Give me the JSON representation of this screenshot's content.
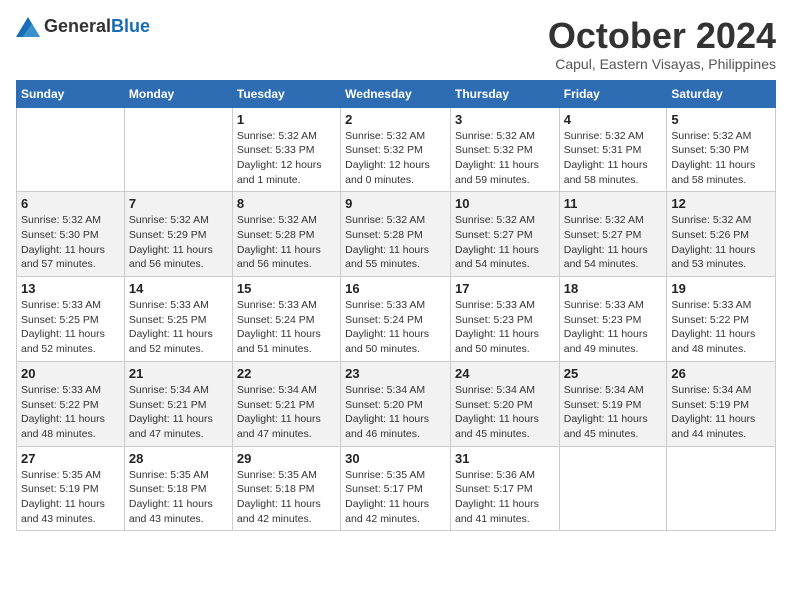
{
  "header": {
    "logo": {
      "general": "General",
      "blue": "Blue"
    },
    "title": "October 2024",
    "subtitle": "Capul, Eastern Visayas, Philippines"
  },
  "columns": [
    "Sunday",
    "Monday",
    "Tuesday",
    "Wednesday",
    "Thursday",
    "Friday",
    "Saturday"
  ],
  "weeks": [
    [
      {
        "day": "",
        "sunrise": "",
        "sunset": "",
        "daylight": ""
      },
      {
        "day": "",
        "sunrise": "",
        "sunset": "",
        "daylight": ""
      },
      {
        "day": "1",
        "sunrise": "Sunrise: 5:32 AM",
        "sunset": "Sunset: 5:33 PM",
        "daylight": "Daylight: 12 hours and 1 minute."
      },
      {
        "day": "2",
        "sunrise": "Sunrise: 5:32 AM",
        "sunset": "Sunset: 5:32 PM",
        "daylight": "Daylight: 12 hours and 0 minutes."
      },
      {
        "day": "3",
        "sunrise": "Sunrise: 5:32 AM",
        "sunset": "Sunset: 5:32 PM",
        "daylight": "Daylight: 11 hours and 59 minutes."
      },
      {
        "day": "4",
        "sunrise": "Sunrise: 5:32 AM",
        "sunset": "Sunset: 5:31 PM",
        "daylight": "Daylight: 11 hours and 58 minutes."
      },
      {
        "day": "5",
        "sunrise": "Sunrise: 5:32 AM",
        "sunset": "Sunset: 5:30 PM",
        "daylight": "Daylight: 11 hours and 58 minutes."
      }
    ],
    [
      {
        "day": "6",
        "sunrise": "Sunrise: 5:32 AM",
        "sunset": "Sunset: 5:30 PM",
        "daylight": "Daylight: 11 hours and 57 minutes."
      },
      {
        "day": "7",
        "sunrise": "Sunrise: 5:32 AM",
        "sunset": "Sunset: 5:29 PM",
        "daylight": "Daylight: 11 hours and 56 minutes."
      },
      {
        "day": "8",
        "sunrise": "Sunrise: 5:32 AM",
        "sunset": "Sunset: 5:28 PM",
        "daylight": "Daylight: 11 hours and 56 minutes."
      },
      {
        "day": "9",
        "sunrise": "Sunrise: 5:32 AM",
        "sunset": "Sunset: 5:28 PM",
        "daylight": "Daylight: 11 hours and 55 minutes."
      },
      {
        "day": "10",
        "sunrise": "Sunrise: 5:32 AM",
        "sunset": "Sunset: 5:27 PM",
        "daylight": "Daylight: 11 hours and 54 minutes."
      },
      {
        "day": "11",
        "sunrise": "Sunrise: 5:32 AM",
        "sunset": "Sunset: 5:27 PM",
        "daylight": "Daylight: 11 hours and 54 minutes."
      },
      {
        "day": "12",
        "sunrise": "Sunrise: 5:32 AM",
        "sunset": "Sunset: 5:26 PM",
        "daylight": "Daylight: 11 hours and 53 minutes."
      }
    ],
    [
      {
        "day": "13",
        "sunrise": "Sunrise: 5:33 AM",
        "sunset": "Sunset: 5:25 PM",
        "daylight": "Daylight: 11 hours and 52 minutes."
      },
      {
        "day": "14",
        "sunrise": "Sunrise: 5:33 AM",
        "sunset": "Sunset: 5:25 PM",
        "daylight": "Daylight: 11 hours and 52 minutes."
      },
      {
        "day": "15",
        "sunrise": "Sunrise: 5:33 AM",
        "sunset": "Sunset: 5:24 PM",
        "daylight": "Daylight: 11 hours and 51 minutes."
      },
      {
        "day": "16",
        "sunrise": "Sunrise: 5:33 AM",
        "sunset": "Sunset: 5:24 PM",
        "daylight": "Daylight: 11 hours and 50 minutes."
      },
      {
        "day": "17",
        "sunrise": "Sunrise: 5:33 AM",
        "sunset": "Sunset: 5:23 PM",
        "daylight": "Daylight: 11 hours and 50 minutes."
      },
      {
        "day": "18",
        "sunrise": "Sunrise: 5:33 AM",
        "sunset": "Sunset: 5:23 PM",
        "daylight": "Daylight: 11 hours and 49 minutes."
      },
      {
        "day": "19",
        "sunrise": "Sunrise: 5:33 AM",
        "sunset": "Sunset: 5:22 PM",
        "daylight": "Daylight: 11 hours and 48 minutes."
      }
    ],
    [
      {
        "day": "20",
        "sunrise": "Sunrise: 5:33 AM",
        "sunset": "Sunset: 5:22 PM",
        "daylight": "Daylight: 11 hours and 48 minutes."
      },
      {
        "day": "21",
        "sunrise": "Sunrise: 5:34 AM",
        "sunset": "Sunset: 5:21 PM",
        "daylight": "Daylight: 11 hours and 47 minutes."
      },
      {
        "day": "22",
        "sunrise": "Sunrise: 5:34 AM",
        "sunset": "Sunset: 5:21 PM",
        "daylight": "Daylight: 11 hours and 47 minutes."
      },
      {
        "day": "23",
        "sunrise": "Sunrise: 5:34 AM",
        "sunset": "Sunset: 5:20 PM",
        "daylight": "Daylight: 11 hours and 46 minutes."
      },
      {
        "day": "24",
        "sunrise": "Sunrise: 5:34 AM",
        "sunset": "Sunset: 5:20 PM",
        "daylight": "Daylight: 11 hours and 45 minutes."
      },
      {
        "day": "25",
        "sunrise": "Sunrise: 5:34 AM",
        "sunset": "Sunset: 5:19 PM",
        "daylight": "Daylight: 11 hours and 45 minutes."
      },
      {
        "day": "26",
        "sunrise": "Sunrise: 5:34 AM",
        "sunset": "Sunset: 5:19 PM",
        "daylight": "Daylight: 11 hours and 44 minutes."
      }
    ],
    [
      {
        "day": "27",
        "sunrise": "Sunrise: 5:35 AM",
        "sunset": "Sunset: 5:19 PM",
        "daylight": "Daylight: 11 hours and 43 minutes."
      },
      {
        "day": "28",
        "sunrise": "Sunrise: 5:35 AM",
        "sunset": "Sunset: 5:18 PM",
        "daylight": "Daylight: 11 hours and 43 minutes."
      },
      {
        "day": "29",
        "sunrise": "Sunrise: 5:35 AM",
        "sunset": "Sunset: 5:18 PM",
        "daylight": "Daylight: 11 hours and 42 minutes."
      },
      {
        "day": "30",
        "sunrise": "Sunrise: 5:35 AM",
        "sunset": "Sunset: 5:17 PM",
        "daylight": "Daylight: 11 hours and 42 minutes."
      },
      {
        "day": "31",
        "sunrise": "Sunrise: 5:36 AM",
        "sunset": "Sunset: 5:17 PM",
        "daylight": "Daylight: 11 hours and 41 minutes."
      },
      {
        "day": "",
        "sunrise": "",
        "sunset": "",
        "daylight": ""
      },
      {
        "day": "",
        "sunrise": "",
        "sunset": "",
        "daylight": ""
      }
    ]
  ]
}
